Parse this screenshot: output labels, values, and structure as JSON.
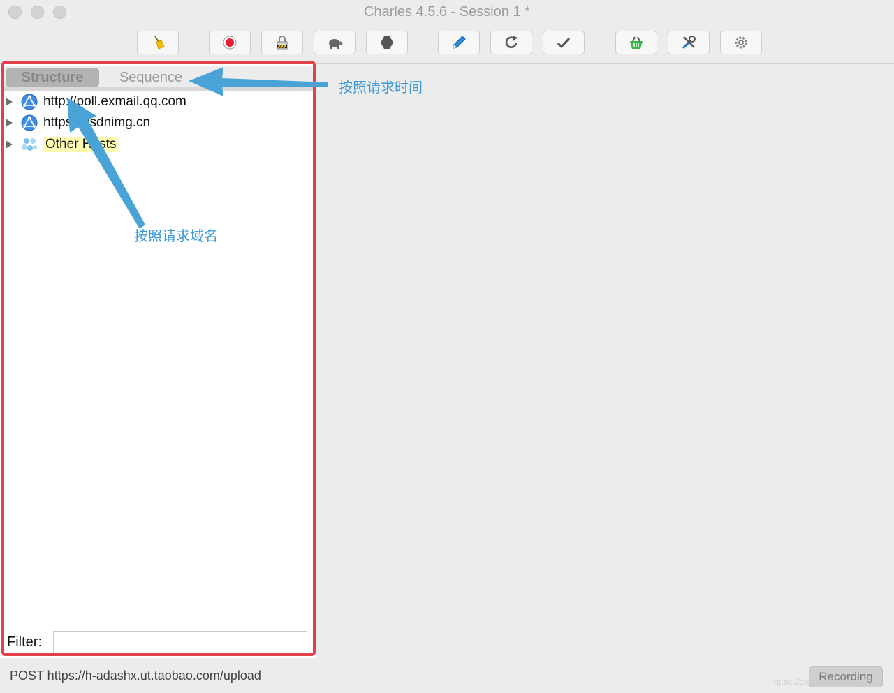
{
  "window": {
    "title": "Charles 4.5.6 - Session 1 *"
  },
  "toolbar": {
    "buttons": [
      {
        "icon": "broom-icon",
        "label": "Clear"
      },
      {
        "icon": "record-icon",
        "label": "Record"
      },
      {
        "icon": "ssl-proxy-lock-icon",
        "label": "SSL Proxying"
      },
      {
        "icon": "turtle-icon",
        "label": "Throttle"
      },
      {
        "icon": "stop-hexagon-icon",
        "label": "Breakpoints"
      },
      {
        "icon": "pen-icon",
        "label": "Compose"
      },
      {
        "icon": "refresh-icon",
        "label": "Repeat"
      },
      {
        "icon": "check-icon",
        "label": "Validate"
      },
      {
        "icon": "basket-icon",
        "label": "Tools"
      },
      {
        "icon": "tools-icon",
        "label": "Tools"
      },
      {
        "icon": "gear-icon",
        "label": "Settings"
      }
    ]
  },
  "tabs": {
    "structure": "Structure",
    "sequence": "Sequence"
  },
  "tree": {
    "items": [
      {
        "label": "http://poll.exmail.qq.com",
        "icon": "globe-icon"
      },
      {
        "label": "https://csdnimg.cn",
        "icon": "globe-icon"
      },
      {
        "label": "Other Hosts",
        "icon": "cluster-icon",
        "highlighted": true
      }
    ]
  },
  "filter": {
    "label": "Filter:",
    "value": ""
  },
  "status": {
    "text": "POST https://h-adashx.ut.taobao.com/upload",
    "recording_button": "Recording",
    "watermark": "https://blog.csdn.net/cy_3720"
  },
  "annotations": {
    "by_time": "按照请求时间",
    "by_domain": "按照请求域名"
  },
  "colors": {
    "annotation": "#3a9ad9",
    "arrow": "#4aa3d6",
    "frame": "#e2404a",
    "highlight": "#fffbb0"
  }
}
